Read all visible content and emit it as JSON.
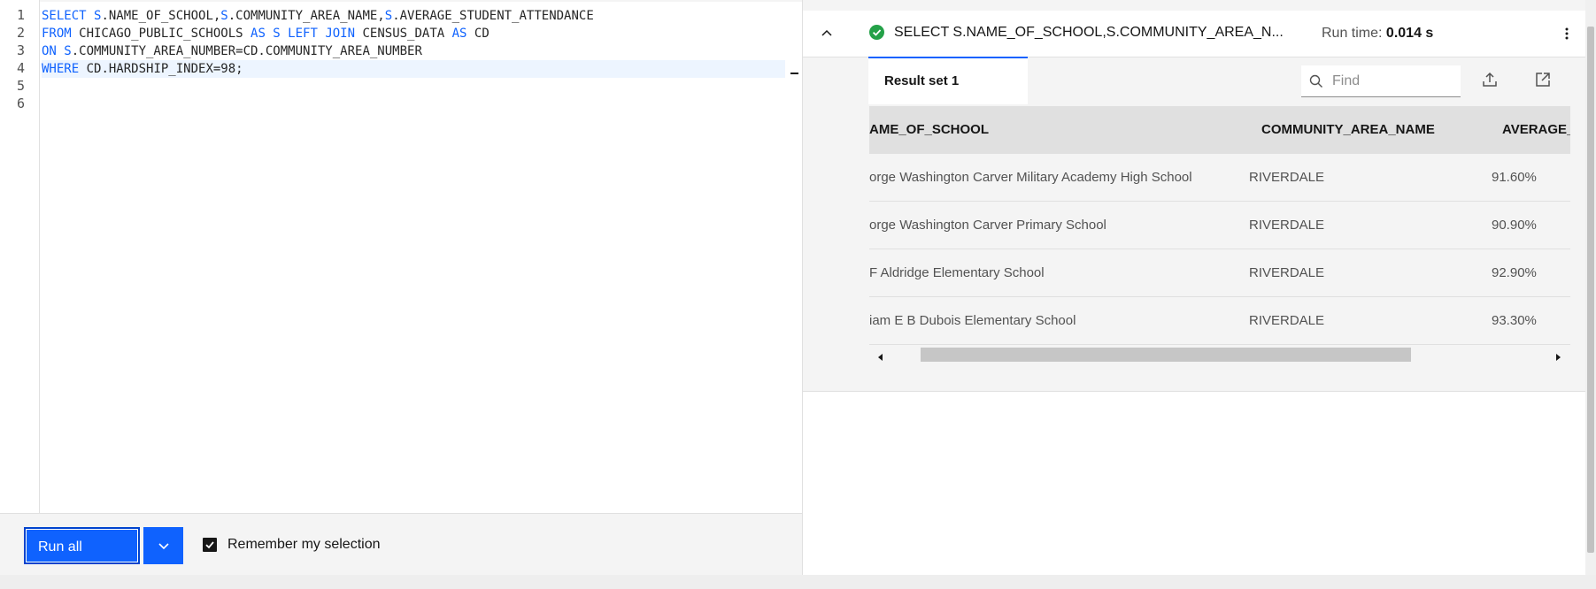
{
  "editor": {
    "line_numbers": [
      "1",
      "2",
      "3",
      "4",
      "5",
      "6"
    ],
    "code": [
      [
        "SELECT",
        " S",
        ".NAME_OF_SCHOOL,",
        "S",
        ".COMMUNITY_AREA_NAME,",
        "S",
        ".AVERAGE_STUDENT_ATTENDANCE"
      ],
      [
        "FROM",
        " CHICAGO_PUBLIC_SCHOOLS ",
        "AS",
        " S ",
        "LEFT",
        " ",
        "JOIN",
        " CENSUS_DATA ",
        "AS",
        " CD"
      ],
      [
        "ON",
        " S",
        ".COMMUNITY_AREA_NUMBER=CD.COMMUNITY_AREA_NUMBER"
      ],
      [
        "WHERE",
        " CD.HARDSHIP_INDEX=98;"
      ]
    ],
    "run_all_label": "Run all",
    "remember_label": "Remember my selection",
    "remember_checked": true
  },
  "results": {
    "query_title": "SELECT S.NAME_OF_SCHOOL,S.COMMUNITY_AREA_N...",
    "status": "success",
    "runtime_label": "Run time:",
    "runtime_value": "0.014 s",
    "tab_label": "Result set 1",
    "find_placeholder": "Find",
    "columns": [
      "AME_OF_SCHOOL",
      "COMMUNITY_AREA_NAME",
      "AVERAGE_"
    ],
    "rows": [
      [
        "orge Washington Carver Military Academy High School",
        "RIVERDALE",
        "91.60%"
      ],
      [
        "orge Washington Carver Primary School",
        "RIVERDALE",
        "90.90%"
      ],
      [
        "F Aldridge Elementary School",
        "RIVERDALE",
        "92.90%"
      ],
      [
        "iam E B Dubois Elementary School",
        "RIVERDALE",
        "93.30%"
      ]
    ]
  },
  "colors": {
    "accent": "#0f62fe",
    "success": "#24a148",
    "keyword": "#0f62fe"
  }
}
